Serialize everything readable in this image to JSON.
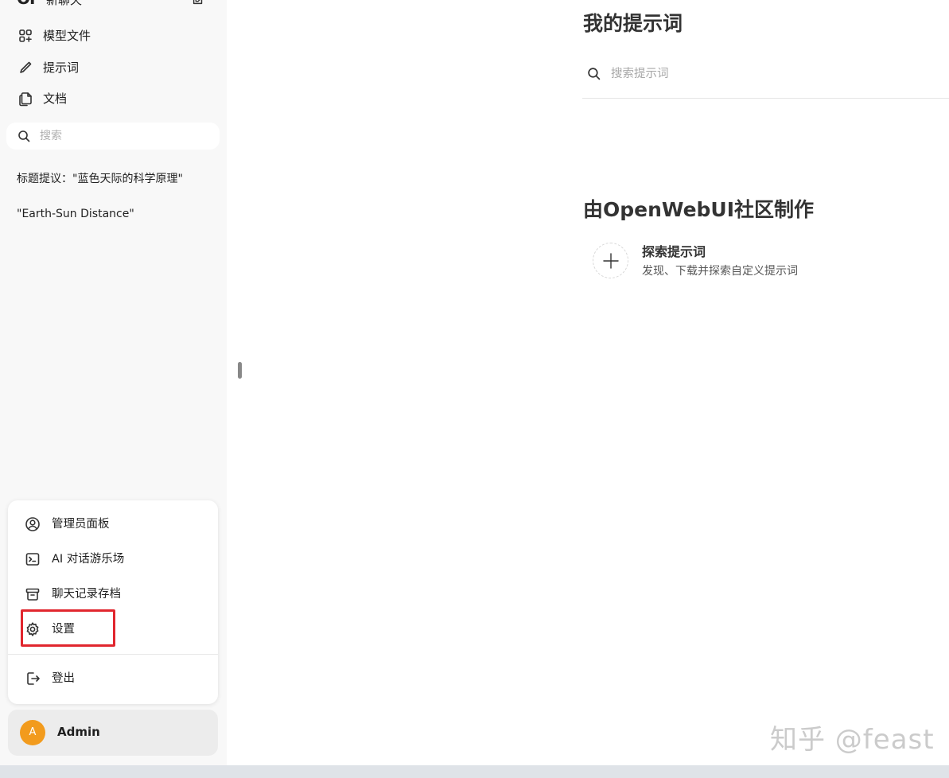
{
  "sidebar": {
    "logo": "OI",
    "new_chat_label": "新聊天",
    "nav": [
      {
        "label": "模型文件",
        "icon": "grid-plus-icon"
      },
      {
        "label": "提示词",
        "icon": "pencil-icon"
      },
      {
        "label": "文档",
        "icon": "documents-icon"
      }
    ],
    "search_placeholder": "搜索",
    "chats": [
      {
        "title": "标题提议：\"蓝色天际的科学原理\""
      },
      {
        "title": "\"Earth-Sun Distance\""
      }
    ]
  },
  "user_menu": {
    "items": [
      {
        "label": "管理员面板",
        "icon": "user-circle-icon"
      },
      {
        "label": "AI 对话游乐场",
        "icon": "terminal-icon"
      },
      {
        "label": "聊天记录存档",
        "icon": "archive-icon"
      },
      {
        "label": "设置",
        "icon": "gear-icon"
      }
    ],
    "logout_label": "登出",
    "highlighted_item": "设置",
    "highlight_color": "#e1262e"
  },
  "user": {
    "avatar_initial": "A",
    "name": "Admin",
    "avatar_color": "#f29b1d"
  },
  "main": {
    "title": "我的提示词",
    "search_placeholder": "搜索提示词",
    "community_title": "由OpenWebUI社区制作",
    "discover": {
      "title": "探索提示词",
      "description": "发现、下载并探索自定义提示词"
    }
  },
  "watermark": "知乎 @feast"
}
